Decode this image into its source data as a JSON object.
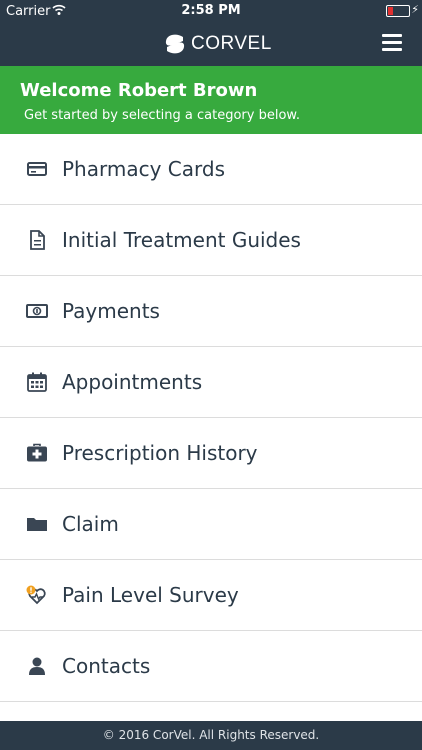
{
  "status_bar": {
    "carrier": "Carrier",
    "time": "2:58 PM",
    "wifi_icon": "wifi-icon",
    "battery_icon": "battery-low-charging-icon"
  },
  "header": {
    "brand": "CORVEL",
    "menu_icon": "hamburger-icon"
  },
  "welcome": {
    "title": "Welcome Robert Brown",
    "subtitle": "Get started by selecting a category below."
  },
  "menu": {
    "items": [
      {
        "label": "Pharmacy Cards",
        "icon": "credit-card-icon"
      },
      {
        "label": "Initial Treatment Guides",
        "icon": "document-icon"
      },
      {
        "label": "Payments",
        "icon": "money-icon"
      },
      {
        "label": "Appointments",
        "icon": "calendar-icon"
      },
      {
        "label": "Prescription History",
        "icon": "medical-kit-icon"
      },
      {
        "label": "Claim",
        "icon": "folder-icon"
      },
      {
        "label": "Pain Level Survey",
        "icon": "pain-survey-icon"
      },
      {
        "label": "Contacts",
        "icon": "user-icon"
      }
    ]
  },
  "footer": {
    "copyright": "© 2016 CorVel. All Rights Reserved."
  },
  "colors": {
    "navbar": "#2b3a48",
    "welcome": "#37aa3e",
    "alert": "#f0a020"
  }
}
